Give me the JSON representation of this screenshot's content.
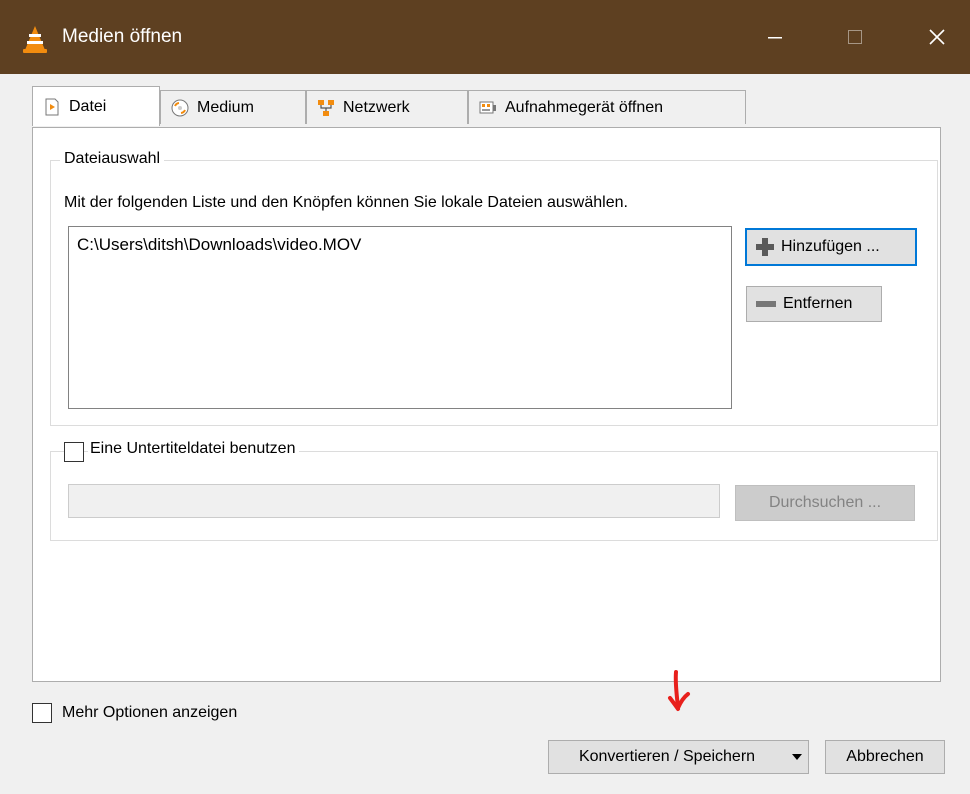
{
  "window": {
    "title": "Medien öffnen"
  },
  "tabs": [
    {
      "label": "Datei",
      "icon": "file-icon",
      "active": true
    },
    {
      "label": "Medium",
      "icon": "disc-icon",
      "active": false
    },
    {
      "label": "Netzwerk",
      "icon": "network-icon",
      "active": false
    },
    {
      "label": "Aufnahmegerät öffnen",
      "icon": "capture-device-icon",
      "active": false
    }
  ],
  "file_selection": {
    "legend": "Dateiauswahl",
    "description": "Mit der folgenden Liste und den Knöpfen können Sie lokale Dateien auswählen.",
    "files": [
      "C:\\Users\\ditsh\\Downloads\\video.MOV"
    ],
    "add_label": "Hinzufügen ...",
    "remove_label": "Entfernen"
  },
  "subtitle": {
    "checkbox_label": "Eine Untertiteldatei benutzen",
    "checked": false,
    "path_value": "",
    "browse_label": "Durchsuchen ..."
  },
  "footer": {
    "more_options_label": "Mehr Optionen anzeigen",
    "more_options_checked": false,
    "convert_label": "Konvertieren / Speichern",
    "cancel_label": "Abbrechen"
  },
  "colors": {
    "titlebar": "#5e4021",
    "focus": "#0078d7",
    "annotation": "#e8201c"
  }
}
